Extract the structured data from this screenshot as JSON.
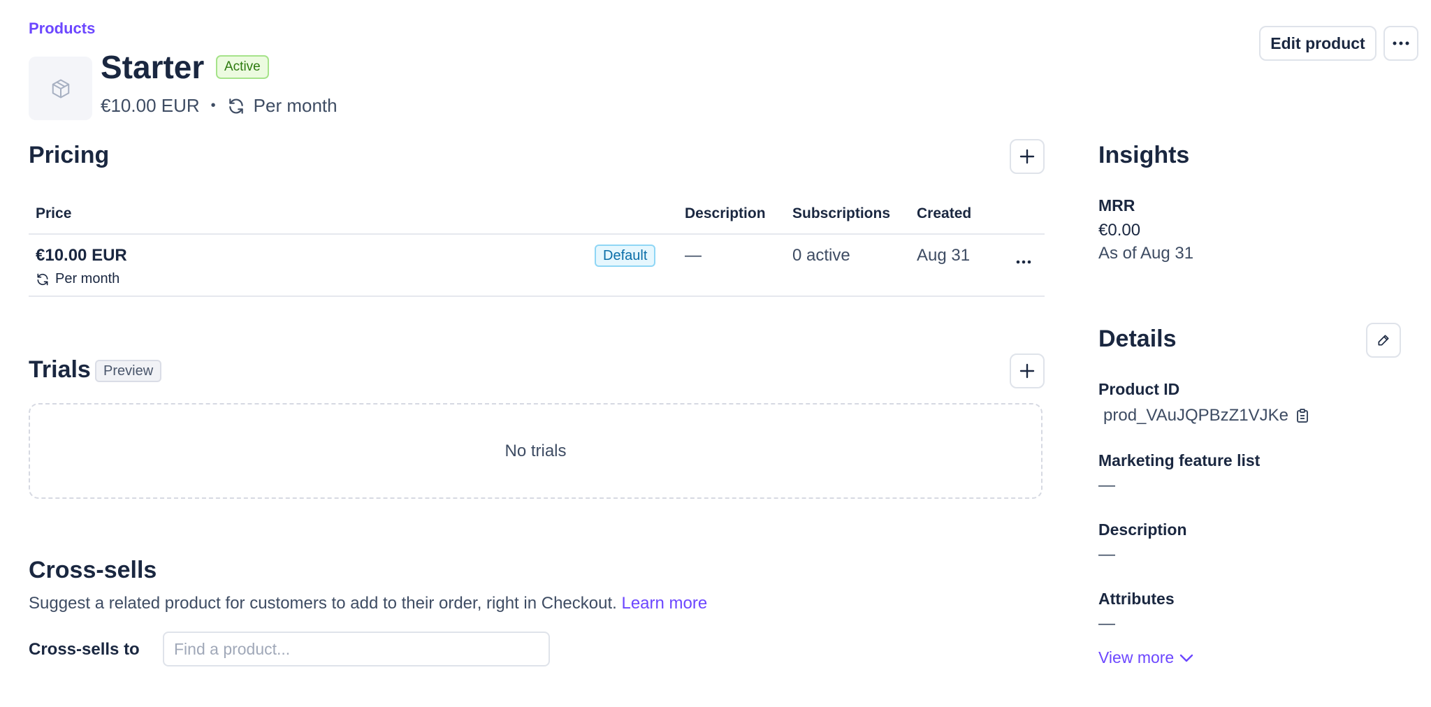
{
  "breadcrumb": "Products",
  "header": {
    "edit_button": "Edit product",
    "more_icon": "ellipsis-icon"
  },
  "product": {
    "name": "Starter",
    "status": "Active",
    "price": "€10.00 EUR",
    "separator": "•",
    "interval": "Per month"
  },
  "pricing": {
    "title": "Pricing",
    "columns": [
      "Price",
      "Description",
      "Subscriptions",
      "Created"
    ],
    "rows": [
      {
        "price": "€10.00 EUR",
        "interval": "Per month",
        "badge": "Default",
        "description": "—",
        "subscriptions": "0 active",
        "created": "Aug 31"
      }
    ]
  },
  "trials": {
    "title": "Trials",
    "badge": "Preview",
    "empty_text": "No trials"
  },
  "cross_sells": {
    "title": "Cross-sells",
    "description": "Suggest a related product for customers to add to their order, right in Checkout.",
    "learn_more": "Learn more",
    "label": "Cross-sells to",
    "placeholder": "Find a product..."
  },
  "insights": {
    "title": "Insights",
    "mrr_label": "MRR",
    "mrr_value": "€0.00",
    "as_of": "As of Aug 31"
  },
  "details": {
    "title": "Details",
    "product_id_label": "Product ID",
    "product_id": "prod_VAuJQPBzZ1VJKe",
    "marketing_label": "Marketing feature list",
    "marketing_value": "—",
    "description_label": "Description",
    "description_value": "—",
    "attributes_label": "Attributes",
    "attributes_value": "—",
    "view_more": "View more"
  },
  "colors": {
    "accent": "#6c47ff",
    "active_badge_bg": "#ecfbe0",
    "default_badge_bg": "#e6f7fe"
  }
}
